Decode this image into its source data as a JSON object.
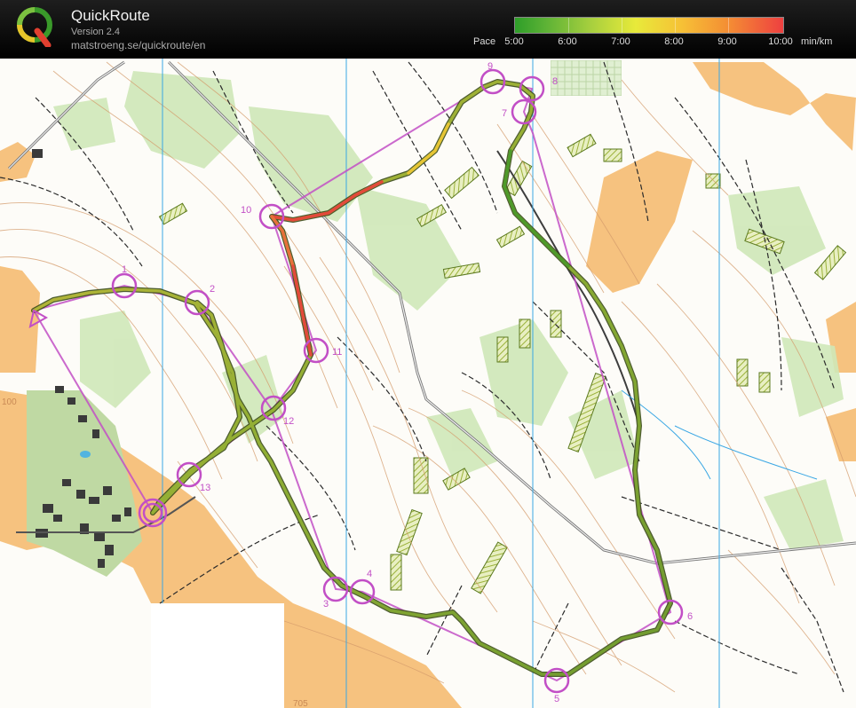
{
  "app": {
    "title": "QuickRoute",
    "version": "Version 2.4",
    "url": "matstroeng.se/quickroute/en"
  },
  "pace_scale": {
    "label": "Pace",
    "unit": "min/km",
    "ticks": [
      "5:00",
      "6:00",
      "7:00",
      "8:00",
      "9:00",
      "10:00"
    ],
    "colors": [
      "#2e9e29",
      "#5fb336",
      "#a6cf3e",
      "#e8ea3a",
      "#f6c136",
      "#f48c34",
      "#ee4040"
    ]
  },
  "map": {
    "course_color": "#c24fc6",
    "route_color": "#7a9a2a",
    "controls": [
      "1",
      "2",
      "3",
      "4",
      "5",
      "6",
      "7",
      "8",
      "9",
      "10",
      "11",
      "12",
      "13"
    ],
    "elevation_labels": [
      "100",
      "705"
    ]
  }
}
